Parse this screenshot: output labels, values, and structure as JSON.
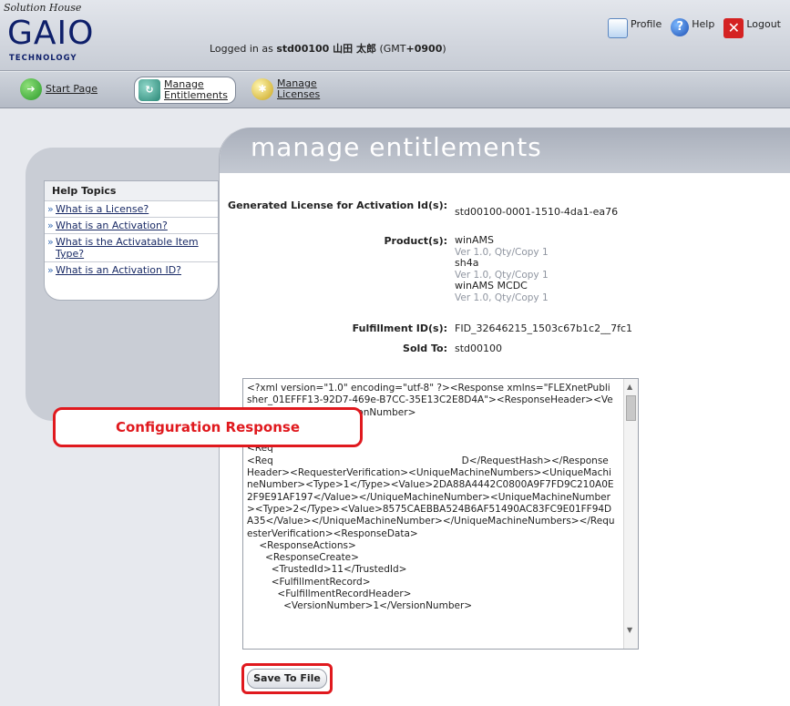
{
  "header": {
    "logo_script": "Solution House",
    "logo_name": "GAIO",
    "logo_sub": "TECHNOLOGY",
    "login_prefix": "Logged in as",
    "login_user": "std00100 山田 太郎",
    "login_tz_prefix": "(GMT",
    "login_tz": "+0900",
    "login_tz_suffix": ")",
    "links": {
      "profile": "Profile",
      "help": "Help",
      "logout": "Logout"
    }
  },
  "nav": {
    "start": "Start Page",
    "entitlements_1": "Manage",
    "entitlements_2": "Entitlements",
    "licenses_1": "Manage",
    "licenses_2": "Licenses"
  },
  "sidebar": {
    "title": "Help Topics",
    "items": [
      {
        "label": "What is a License?"
      },
      {
        "label": "What is an Activation?"
      },
      {
        "label": "What is the Activatable Item Type?"
      },
      {
        "label": "What is an Activation ID?"
      }
    ]
  },
  "page": {
    "title": "manage entitlements",
    "fields": {
      "license_label": "Generated License for Activation Id(s):",
      "license_value": "std00100-0001-1510-4da1-ea76",
      "products_label": "Product(s):",
      "products": [
        {
          "name": "winAMS",
          "detail": "Ver 1.0, Qty/Copy 1"
        },
        {
          "name": "sh4a",
          "detail": "Ver 1.0, Qty/Copy 1"
        },
        {
          "name": "winAMS MCDC",
          "detail": "Ver 1.0, Qty/Copy 1"
        }
      ],
      "fulfillment_label": "Fulfillment ID(s):",
      "fulfillment_value": "FID_32646215_1503c67b1c2__7fc1",
      "sold_label": "Sold To:",
      "sold_value": "std00100"
    },
    "xml_text": "<?xml version=\"1.0\" encoding=\"utf-8\" ?><Response xmlns=\"FLEXnetPublisher_01EFFF13-92D7-469e-B7CC-35E13C2E8D4A\"><ResponseHeader><VersionNumber>5</VersionNumber>\n<Ver\n<Res\n<Req\n<Req                                                              D</RequestHash></ResponseHeader><RequesterVerification><UniqueMachineNumbers><UniqueMachineNumber><Type>1</Type><Value>2DA88A4442C0800A9F7FD9C210A0E2F9E91AF197</Value></UniqueMachineNumber><UniqueMachineNumber><Type>2</Type><Value>8575CAEBBA524B6AF51490AC83FC9E01FF94DA35</Value></UniqueMachineNumber></UniqueMachineNumbers></RequesterVerification><ResponseData>\n    <ResponseActions>\n      <ResponseCreate>\n        <TrustedId>11</TrustedId>\n        <FulfillmentRecord>\n          <FulfillmentRecordHeader>\n            <VersionNumber>1</VersionNumber>",
    "callout": "Configuration Response",
    "save_label": "Save To File"
  }
}
